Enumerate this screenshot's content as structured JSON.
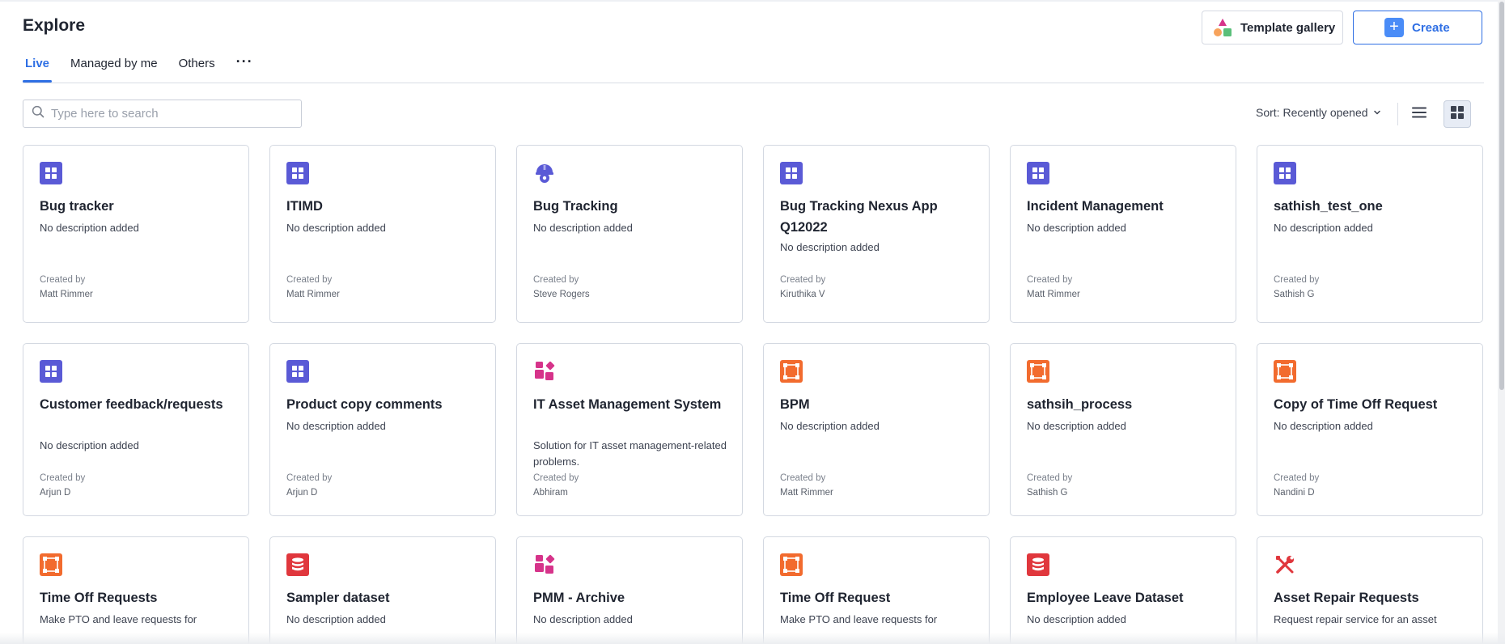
{
  "page": {
    "title": "Explore"
  },
  "header": {
    "template_gallery_label": "Template gallery",
    "create_label": "Create",
    "create_icon": "+"
  },
  "tabs": [
    {
      "label": "Live",
      "active": true
    },
    {
      "label": "Managed by me",
      "active": false
    },
    {
      "label": "Others",
      "active": false
    }
  ],
  "tabs_more": "···",
  "search": {
    "placeholder": "Type here to search",
    "value": ""
  },
  "sort": {
    "label": "Sort: Recently opened"
  },
  "colors": {
    "accent": "#2f6fe4",
    "app_purple": "#5a5ad6",
    "process_orange": "#f26b2e",
    "dataset_red": "#e0373d",
    "pink": "#d6338a"
  },
  "cards": [
    {
      "title": "Bug tracker",
      "description": "No description added",
      "created_by_label": "Created by",
      "created_by": "Matt Rimmer",
      "icon": "app-grid-icon"
    },
    {
      "title": "ITIMD",
      "description": "No description added",
      "created_by_label": "Created by",
      "created_by": "Matt Rimmer",
      "icon": "app-grid-icon"
    },
    {
      "title": "Bug Tracking",
      "description": "No description added",
      "created_by_label": "Created by",
      "created_by": "Steve Rogers",
      "icon": "bug-gear-icon"
    },
    {
      "title": "Bug Tracking Nexus App Q12022",
      "description": "No description added",
      "created_by_label": "Created by",
      "created_by": "Kiruthika V",
      "icon": "app-grid-icon"
    },
    {
      "title": "Incident Management",
      "description": "No description added",
      "created_by_label": "Created by",
      "created_by": "Matt Rimmer",
      "icon": "app-grid-icon"
    },
    {
      "title": "sathish_test_one",
      "description": "No description added",
      "created_by_label": "Created by",
      "created_by": "Sathish G",
      "icon": "app-grid-icon"
    },
    {
      "title": "Customer feedback/requests",
      "description": "No description added",
      "created_by_label": "Created by",
      "created_by": "Arjun D",
      "icon": "app-grid-icon"
    },
    {
      "title": "Product copy comments",
      "description": "No description added",
      "created_by_label": "Created by",
      "created_by": "Arjun D",
      "icon": "app-grid-icon"
    },
    {
      "title": "IT Asset Management System",
      "description": "Solution for IT asset management-related problems.",
      "created_by_label": "Created by",
      "created_by": "Abhiram",
      "icon": "solution-shapes-icon"
    },
    {
      "title": "BPM",
      "description": "No description added",
      "created_by_label": "Created by",
      "created_by": "Matt Rimmer",
      "icon": "process-nodes-icon"
    },
    {
      "title": "sathsih_process",
      "description": "No description added",
      "created_by_label": "Created by",
      "created_by": "Sathish G",
      "icon": "process-nodes-icon"
    },
    {
      "title": "Copy of Time Off Request",
      "description": "No description added",
      "created_by_label": "Created by",
      "created_by": "Nandini D",
      "icon": "process-nodes-icon"
    },
    {
      "title": "Time Off Requests",
      "description": "Make PTO and leave requests for",
      "created_by_label": "",
      "created_by": "",
      "icon": "process-nodes-icon"
    },
    {
      "title": "Sampler dataset",
      "description": "No description added",
      "created_by_label": "",
      "created_by": "",
      "icon": "database-icon"
    },
    {
      "title": "PMM - Archive",
      "description": "No description added",
      "created_by_label": "",
      "created_by": "",
      "icon": "solution-shapes-icon"
    },
    {
      "title": "Time Off Request",
      "description": "Make PTO and leave requests for",
      "created_by_label": "",
      "created_by": "",
      "icon": "process-nodes-icon"
    },
    {
      "title": "Employee Leave Dataset",
      "description": "No description added",
      "created_by_label": "",
      "created_by": "",
      "icon": "database-icon"
    },
    {
      "title": "Asset Repair Requests",
      "description": "Request repair service for an asset",
      "created_by_label": "",
      "created_by": "",
      "icon": "wrench-screwdriver-icon"
    }
  ]
}
